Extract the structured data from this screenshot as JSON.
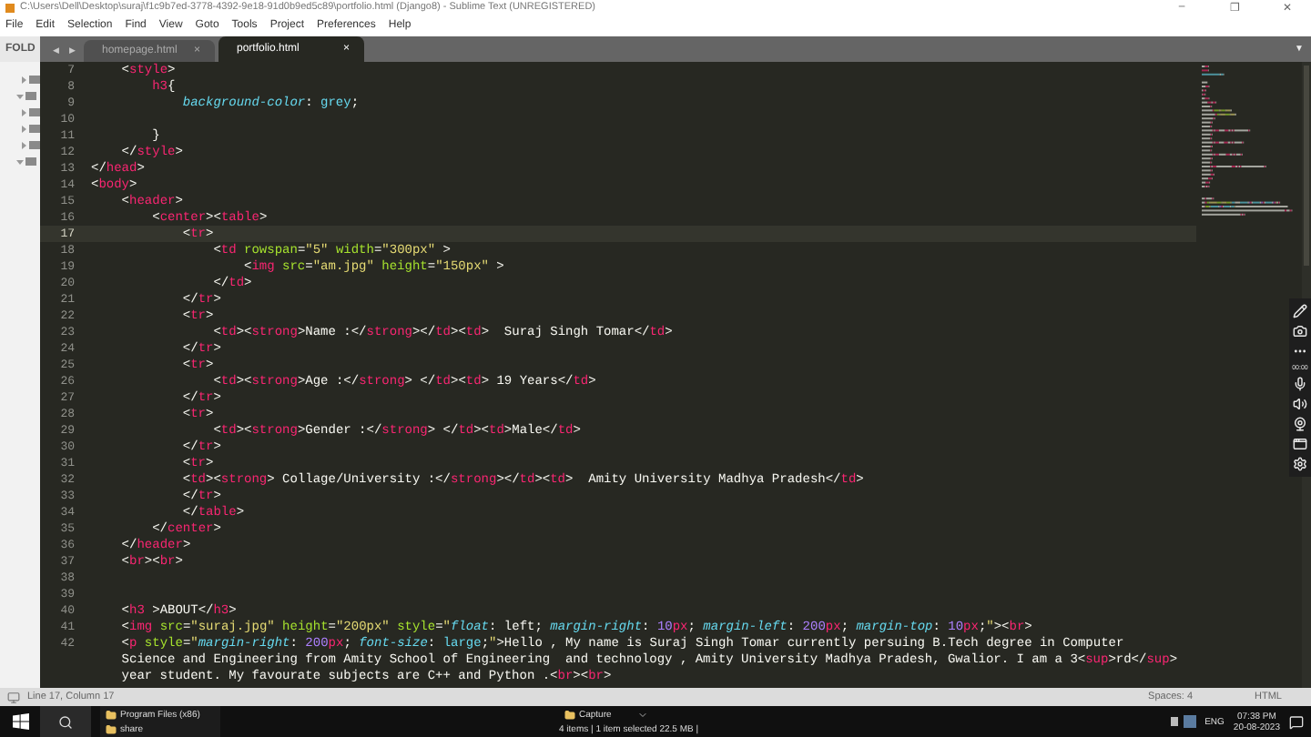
{
  "window": {
    "title": "C:\\Users\\Dell\\Desktop\\suraj\\f1c9b7ed-3778-4392-9e18-91d0b9ed5c89\\portfolio.html (Django8) - Sublime Text (UNREGISTERED)",
    "controls": [
      "–",
      "❐",
      "✕"
    ]
  },
  "menu": [
    "File",
    "Edit",
    "Selection",
    "Find",
    "View",
    "Goto",
    "Tools",
    "Project",
    "Preferences",
    "Help"
  ],
  "sidebar": {
    "header": "FOLD",
    "folders": [
      {
        "expanded": false
      },
      {
        "expanded": true
      },
      {
        "expanded": false
      },
      {
        "expanded": false
      },
      {
        "expanded": false
      },
      {
        "expanded": true
      }
    ]
  },
  "tab_nav": [
    "◀",
    "▶"
  ],
  "tabs": [
    {
      "label": "homepage.html",
      "selected": false,
      "close": "×"
    },
    {
      "label": "portfolio.html",
      "selected": true,
      "close": "×"
    }
  ],
  "tab_menu": "▼",
  "editor": {
    "lines": [
      {
        "number": "7",
        "current": false,
        "tokens": [
          {
            "kind": "plain",
            "text": "    <"
          },
          {
            "kind": "tag",
            "text": "style"
          },
          {
            "kind": "plain",
            "text": ">"
          }
        ]
      },
      {
        "number": "8",
        "current": false,
        "tokens": [
          {
            "kind": "tag",
            "text": "        h3"
          },
          {
            "kind": "plain",
            "text": "{"
          }
        ]
      },
      {
        "number": "9",
        "current": false,
        "tokens": [
          {
            "kind": "property",
            "text": "            background-color"
          },
          {
            "kind": "plain",
            "text": ": "
          },
          {
            "kind": "value",
            "text": "grey"
          },
          {
            "kind": "plain",
            "text": ";"
          }
        ]
      },
      {
        "number": "10",
        "current": false
      },
      {
        "number": "11",
        "current": false,
        "tokens": [
          {
            "kind": "plain",
            "text": "        }"
          }
        ]
      },
      {
        "number": "12",
        "current": false,
        "tokens": [
          {
            "kind": "plain",
            "text": "    </"
          },
          {
            "kind": "tag",
            "text": "style"
          },
          {
            "kind": "plain",
            "text": ">"
          }
        ]
      },
      {
        "number": "13",
        "current": false,
        "tokens": [
          {
            "kind": "plain",
            "text": "</"
          },
          {
            "kind": "tag",
            "text": "head"
          },
          {
            "kind": "plain",
            "text": ">"
          }
        ]
      },
      {
        "number": "14",
        "current": false,
        "tokens": [
          {
            "kind": "plain",
            "text": "<"
          },
          {
            "kind": "tag",
            "text": "body"
          },
          {
            "kind": "plain",
            "text": ">"
          }
        ]
      },
      {
        "number": "15",
        "current": false,
        "tokens": [
          {
            "kind": "plain",
            "text": "    <"
          },
          {
            "kind": "tag",
            "text": "header"
          },
          {
            "kind": "plain",
            "text": ">"
          }
        ]
      },
      {
        "number": "16",
        "current": false,
        "tokens": [
          {
            "kind": "plain",
            "text": "        <"
          },
          {
            "kind": "tag",
            "text": "center"
          },
          {
            "kind": "plain",
            "text": "><"
          },
          {
            "kind": "tag",
            "text": "table"
          },
          {
            "kind": "plain",
            "text": ">"
          }
        ]
      },
      {
        "number": "17",
        "current": true,
        "tokens": [
          {
            "kind": "plain",
            "text": "            <"
          },
          {
            "kind": "tag",
            "text": "tr"
          },
          {
            "kind": "plain",
            "text": ">"
          }
        ]
      },
      {
        "number": "18",
        "current": false,
        "tokens": [
          {
            "kind": "plain",
            "text": "                <"
          },
          {
            "kind": "tag",
            "text": "td"
          },
          {
            "kind": "attr",
            "text": " rowspan"
          },
          {
            "kind": "plain",
            "text": "="
          },
          {
            "kind": "string",
            "text": "\"5\""
          },
          {
            "kind": "attr",
            "text": " width"
          },
          {
            "kind": "plain",
            "text": "="
          },
          {
            "kind": "string",
            "text": "\"300px\""
          },
          {
            "kind": "plain",
            "text": " >"
          }
        ]
      },
      {
        "number": "19",
        "current": false,
        "tokens": [
          {
            "kind": "plain",
            "text": "                    <"
          },
          {
            "kind": "tag",
            "text": "img"
          },
          {
            "kind": "attr",
            "text": " src"
          },
          {
            "kind": "plain",
            "text": "="
          },
          {
            "kind": "string",
            "text": "\"am.jpg\""
          },
          {
            "kind": "attr",
            "text": " height"
          },
          {
            "kind": "plain",
            "text": "="
          },
          {
            "kind": "string",
            "text": "\"150px\""
          },
          {
            "kind": "plain",
            "text": " >"
          }
        ]
      },
      {
        "number": "20",
        "current": false,
        "tokens": [
          {
            "kind": "plain",
            "text": "                </"
          },
          {
            "kind": "tag",
            "text": "td"
          },
          {
            "kind": "plain",
            "text": ">"
          }
        ]
      },
      {
        "number": "21",
        "current": false,
        "tokens": [
          {
            "kind": "plain",
            "text": "            </"
          },
          {
            "kind": "tag",
            "text": "tr"
          },
          {
            "kind": "plain",
            "text": ">"
          }
        ]
      },
      {
        "number": "22",
        "current": false,
        "tokens": [
          {
            "kind": "plain",
            "text": "            <"
          },
          {
            "kind": "tag",
            "text": "tr"
          },
          {
            "kind": "plain",
            "text": ">"
          }
        ]
      },
      {
        "number": "23",
        "current": false,
        "tokens": [
          {
            "kind": "plain",
            "text": "                <"
          },
          {
            "kind": "tag",
            "text": "td"
          },
          {
            "kind": "plain",
            "text": "><"
          },
          {
            "kind": "tag",
            "text": "strong"
          },
          {
            "kind": "plain",
            "text": ">Name :</"
          },
          {
            "kind": "tag",
            "text": "strong"
          },
          {
            "kind": "plain",
            "text": "></"
          },
          {
            "kind": "tag",
            "text": "td"
          },
          {
            "kind": "plain",
            "text": "><"
          },
          {
            "kind": "tag",
            "text": "td"
          },
          {
            "kind": "plain",
            "text": ">  Suraj Singh Tomar</"
          },
          {
            "kind": "tag",
            "text": "td"
          },
          {
            "kind": "plain",
            "text": ">"
          }
        ]
      },
      {
        "number": "24",
        "current": false,
        "tokens": [
          {
            "kind": "plain",
            "text": "            </"
          },
          {
            "kind": "tag",
            "text": "tr"
          },
          {
            "kind": "plain",
            "text": ">"
          }
        ]
      },
      {
        "number": "25",
        "current": false,
        "tokens": [
          {
            "kind": "plain",
            "text": "            <"
          },
          {
            "kind": "tag",
            "text": "tr"
          },
          {
            "kind": "plain",
            "text": ">"
          }
        ]
      },
      {
        "number": "26",
        "current": false,
        "tokens": [
          {
            "kind": "plain",
            "text": "                <"
          },
          {
            "kind": "tag",
            "text": "td"
          },
          {
            "kind": "plain",
            "text": "><"
          },
          {
            "kind": "tag",
            "text": "strong"
          },
          {
            "kind": "plain",
            "text": ">Age :</"
          },
          {
            "kind": "tag",
            "text": "strong"
          },
          {
            "kind": "plain",
            "text": "> </"
          },
          {
            "kind": "tag",
            "text": "td"
          },
          {
            "kind": "plain",
            "text": "><"
          },
          {
            "kind": "tag",
            "text": "td"
          },
          {
            "kind": "plain",
            "text": "> 19 Years</"
          },
          {
            "kind": "tag",
            "text": "td"
          },
          {
            "kind": "plain",
            "text": ">"
          }
        ]
      },
      {
        "number": "27",
        "current": false,
        "tokens": [
          {
            "kind": "plain",
            "text": "            </"
          },
          {
            "kind": "tag",
            "text": "tr"
          },
          {
            "kind": "plain",
            "text": ">"
          }
        ]
      },
      {
        "number": "28",
        "current": false,
        "tokens": [
          {
            "kind": "plain",
            "text": "            <"
          },
          {
            "kind": "tag",
            "text": "tr"
          },
          {
            "kind": "plain",
            "text": ">"
          }
        ]
      },
      {
        "number": "29",
        "current": false,
        "tokens": [
          {
            "kind": "plain",
            "text": "                <"
          },
          {
            "kind": "tag",
            "text": "td"
          },
          {
            "kind": "plain",
            "text": "><"
          },
          {
            "kind": "tag",
            "text": "strong"
          },
          {
            "kind": "plain",
            "text": ">Gender :</"
          },
          {
            "kind": "tag",
            "text": "strong"
          },
          {
            "kind": "plain",
            "text": "> </"
          },
          {
            "kind": "tag",
            "text": "td"
          },
          {
            "kind": "plain",
            "text": "><"
          },
          {
            "kind": "tag",
            "text": "td"
          },
          {
            "kind": "plain",
            "text": ">Male</"
          },
          {
            "kind": "tag",
            "text": "td"
          },
          {
            "kind": "plain",
            "text": ">"
          }
        ]
      },
      {
        "number": "30",
        "current": false,
        "tokens": [
          {
            "kind": "plain",
            "text": "            </"
          },
          {
            "kind": "tag",
            "text": "tr"
          },
          {
            "kind": "plain",
            "text": ">"
          }
        ]
      },
      {
        "number": "31",
        "current": false,
        "tokens": [
          {
            "kind": "plain",
            "text": "            <"
          },
          {
            "kind": "tag",
            "text": "tr"
          },
          {
            "kind": "plain",
            "text": ">"
          }
        ]
      },
      {
        "number": "32",
        "current": false,
        "tokens": [
          {
            "kind": "plain",
            "text": "            <"
          },
          {
            "kind": "tag",
            "text": "td"
          },
          {
            "kind": "plain",
            "text": "><"
          },
          {
            "kind": "tag",
            "text": "strong"
          },
          {
            "kind": "plain",
            "text": "> Collage/University :</"
          },
          {
            "kind": "tag",
            "text": "strong"
          },
          {
            "kind": "plain",
            "text": "></"
          },
          {
            "kind": "tag",
            "text": "td"
          },
          {
            "kind": "plain",
            "text": "><"
          },
          {
            "kind": "tag",
            "text": "td"
          },
          {
            "kind": "plain",
            "text": ">  Amity University Madhya Pradesh</"
          },
          {
            "kind": "tag",
            "text": "td"
          },
          {
            "kind": "plain",
            "text": ">"
          }
        ]
      },
      {
        "number": "33",
        "current": false,
        "tokens": [
          {
            "kind": "plain",
            "text": "            </"
          },
          {
            "kind": "tag",
            "text": "tr"
          },
          {
            "kind": "plain",
            "text": ">"
          }
        ]
      },
      {
        "number": "34",
        "current": false,
        "tokens": [
          {
            "kind": "plain",
            "text": "            </"
          },
          {
            "kind": "tag",
            "text": "table"
          },
          {
            "kind": "plain",
            "text": ">"
          }
        ]
      },
      {
        "number": "35",
        "current": false,
        "tokens": [
          {
            "kind": "plain",
            "text": "        </"
          },
          {
            "kind": "tag",
            "text": "center"
          },
          {
            "kind": "plain",
            "text": ">"
          }
        ]
      },
      {
        "number": "36",
        "current": false,
        "tokens": [
          {
            "kind": "plain",
            "text": "    </"
          },
          {
            "kind": "tag",
            "text": "header"
          },
          {
            "kind": "plain",
            "text": ">"
          }
        ]
      },
      {
        "number": "37",
        "current": false,
        "tokens": [
          {
            "kind": "plain",
            "text": "    <"
          },
          {
            "kind": "tag",
            "text": "br"
          },
          {
            "kind": "plain",
            "text": "><"
          },
          {
            "kind": "tag",
            "text": "br"
          },
          {
            "kind": "plain",
            "text": ">"
          }
        ]
      },
      {
        "number": "38",
        "current": false
      },
      {
        "number": "39",
        "current": false
      },
      {
        "number": "40",
        "current": false,
        "tokens": [
          {
            "kind": "plain",
            "text": "    <"
          },
          {
            "kind": "tag",
            "text": "h3"
          },
          {
            "kind": "plain",
            "text": " >ABOUT</"
          },
          {
            "kind": "tag",
            "text": "h3"
          },
          {
            "kind": "plain",
            "text": ">"
          }
        ]
      },
      {
        "number": "41",
        "current": false,
        "tokens": [
          {
            "kind": "plain",
            "text": "    <"
          },
          {
            "kind": "tag",
            "text": "img"
          },
          {
            "kind": "attr",
            "text": " src"
          },
          {
            "kind": "plain",
            "text": "="
          },
          {
            "kind": "string",
            "text": "\"suraj.jpg\""
          },
          {
            "kind": "attr",
            "text": " height"
          },
          {
            "kind": "plain",
            "text": "="
          },
          {
            "kind": "string",
            "text": "\"200px\""
          },
          {
            "kind": "attr",
            "text": " style"
          },
          {
            "kind": "plain",
            "text": "="
          },
          {
            "kind": "string",
            "text": "\""
          },
          {
            "kind": "property",
            "text": "float"
          },
          {
            "kind": "plain",
            "text": ": left; "
          },
          {
            "kind": "property",
            "text": "margin-right"
          },
          {
            "kind": "plain",
            "text": ": "
          },
          {
            "kind": "number",
            "text": "10"
          },
          {
            "kind": "tag",
            "text": "px"
          },
          {
            "kind": "plain",
            "text": "; "
          },
          {
            "kind": "property",
            "text": "margin-left"
          },
          {
            "kind": "plain",
            "text": ": "
          },
          {
            "kind": "number",
            "text": "200"
          },
          {
            "kind": "tag",
            "text": "px"
          },
          {
            "kind": "plain",
            "text": "; "
          },
          {
            "kind": "property",
            "text": "margin-top"
          },
          {
            "kind": "plain",
            "text": ": "
          },
          {
            "kind": "number",
            "text": "10"
          },
          {
            "kind": "tag",
            "text": "px"
          },
          {
            "kind": "plain",
            "text": ";"
          },
          {
            "kind": "string",
            "text": "\""
          },
          {
            "kind": "plain",
            "text": "><"
          },
          {
            "kind": "tag",
            "text": "br"
          },
          {
            "kind": "plain",
            "text": ">"
          }
        ]
      },
      {
        "number": "42",
        "current": false,
        "tokens": [
          {
            "kind": "plain",
            "text": "    <"
          },
          {
            "kind": "tag",
            "text": "p"
          },
          {
            "kind": "attr",
            "text": " style"
          },
          {
            "kind": "plain",
            "text": "="
          },
          {
            "kind": "string",
            "text": "\""
          },
          {
            "kind": "property",
            "text": "margin-right"
          },
          {
            "kind": "plain",
            "text": ": "
          },
          {
            "kind": "number",
            "text": "200"
          },
          {
            "kind": "tag",
            "text": "px"
          },
          {
            "kind": "plain",
            "text": "; "
          },
          {
            "kind": "property",
            "text": "font-size"
          },
          {
            "kind": "plain",
            "text": ": "
          },
          {
            "kind": "value",
            "text": "large"
          },
          {
            "kind": "plain",
            "text": ";"
          },
          {
            "kind": "string",
            "text": "\""
          },
          {
            "kind": "plain",
            "text": ">Hello , My name is Suraj Singh Tomar currently persuing B.Tech degree in Computer"
          }
        ]
      },
      {
        "tokens": [
          {
            "kind": "plain",
            "text": "    Science and Engineering from Amity School of Engineering  and technology , Amity University Madhya Pradesh, Gwalior. I am a 3<"
          },
          {
            "kind": "tag",
            "text": "sup"
          },
          {
            "kind": "plain",
            "text": ">rd</"
          },
          {
            "kind": "tag",
            "text": "sup"
          },
          {
            "kind": "plain",
            "text": ">"
          }
        ]
      },
      {
        "tokens": [
          {
            "kind": "plain",
            "text": "    year student. My favourate subjects are C++ and Python .<"
          },
          {
            "kind": "tag",
            "text": "br"
          },
          {
            "kind": "plain",
            "text": "><"
          },
          {
            "kind": "tag",
            "text": "br"
          },
          {
            "kind": "plain",
            "text": ">"
          }
        ]
      }
    ]
  },
  "recorder": {
    "timer": "00:00"
  },
  "status_bar": {
    "position": "Line 17, Column 17",
    "indent": "Spaces: 4",
    "syntax": "HTML"
  },
  "taskbar": {
    "folders": [
      "Program Files (x86)",
      "share"
    ],
    "explorer_folder": "Capture",
    "explorer_status": "4 items  |  1 item selected  22.5 MB  |",
    "language": "ENG",
    "time": "07:38 PM",
    "date": "20-08-2023"
  }
}
